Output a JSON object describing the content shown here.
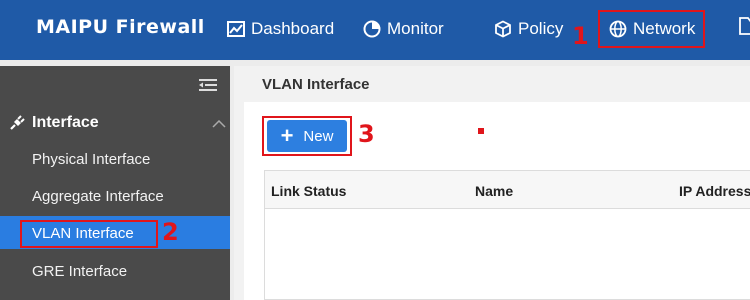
{
  "brand": "MAIPU Firewall",
  "nav": {
    "dashboard": "Dashboard",
    "monitor": "Monitor",
    "policy": "Policy",
    "network": "Network"
  },
  "annotations": [
    "1",
    "2",
    "3"
  ],
  "sidebar": {
    "section": "Interface",
    "items": [
      "Physical Interface",
      "Aggregate Interface",
      "VLAN Interface",
      "GRE Interface"
    ]
  },
  "main": {
    "title": "VLAN Interface",
    "new_button": "New",
    "columns": [
      "Link Status",
      "Name",
      "IP Address"
    ]
  },
  "colors": {
    "topbar": "#1f5aa7",
    "sidebar": "#4a4a4a",
    "active": "#2a7de1",
    "highlight": "#e0151b"
  }
}
